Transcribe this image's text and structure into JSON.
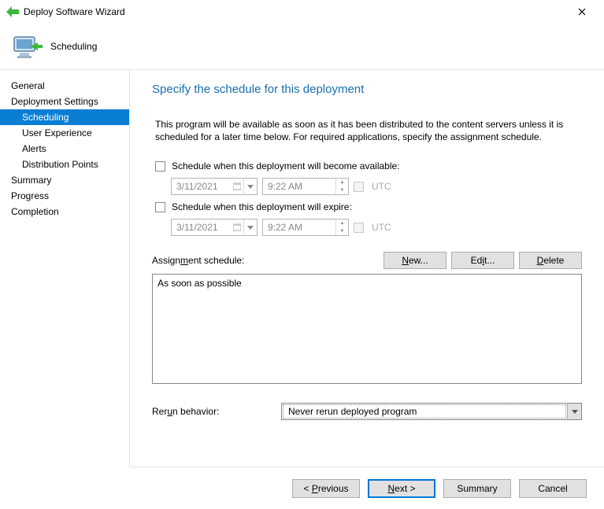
{
  "window": {
    "title": "Deploy Software Wizard"
  },
  "header": {
    "heading": "Scheduling"
  },
  "sidebar": {
    "items": [
      {
        "label": "General",
        "indent": 0,
        "selected": false
      },
      {
        "label": "Deployment Settings",
        "indent": 0,
        "selected": false
      },
      {
        "label": "Scheduling",
        "indent": 1,
        "selected": true
      },
      {
        "label": "User Experience",
        "indent": 1,
        "selected": false
      },
      {
        "label": "Alerts",
        "indent": 1,
        "selected": false
      },
      {
        "label": "Distribution Points",
        "indent": 1,
        "selected": false
      },
      {
        "label": "Summary",
        "indent": 0,
        "selected": false
      },
      {
        "label": "Progress",
        "indent": 0,
        "selected": false
      },
      {
        "label": "Completion",
        "indent": 0,
        "selected": false
      }
    ]
  },
  "page": {
    "title": "Specify the schedule for this deployment",
    "description": "This program will be available as soon as it has been distributed to the content servers unless it is scheduled for a later time below. For required applications, specify the assignment schedule.",
    "available": {
      "label": "Schedule when this deployment will become available:",
      "checked": false,
      "date": "3/11/2021",
      "time": "9:22 AM",
      "utc_label": "UTC"
    },
    "expire": {
      "label": "Schedule when this deployment will expire:",
      "checked": false,
      "date": "3/11/2021",
      "time": "9:22 AM",
      "utc_label": "UTC"
    },
    "assignment": {
      "label": "Assignment schedule:",
      "buttons": {
        "new": "New...",
        "edit": "Edit...",
        "delete": "Delete"
      },
      "items": [
        "As soon as possible"
      ]
    },
    "rerun": {
      "label": "Rerun behavior:",
      "value": "Never rerun deployed program"
    }
  },
  "footer": {
    "previous": "< Previous",
    "next": "Next >",
    "summary": "Summary",
    "cancel": "Cancel"
  }
}
